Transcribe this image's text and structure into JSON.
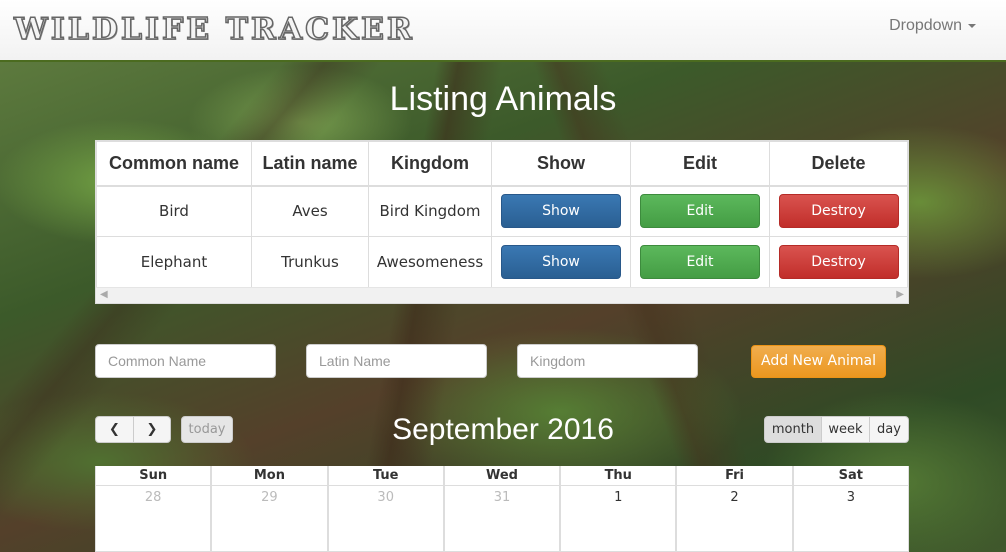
{
  "navbar": {
    "brand": "WILDLIFE TRACKER",
    "dropdown_label": "Dropdown"
  },
  "page_title": "Listing Animals",
  "table": {
    "headers": [
      "Common name",
      "Latin name",
      "Kingdom",
      "Show",
      "Edit",
      "Delete"
    ],
    "rows": [
      {
        "common": "Bird",
        "latin": "Aves",
        "kingdom": "Bird Kingdom",
        "show": "Show",
        "edit": "Edit",
        "destroy": "Destroy"
      },
      {
        "common": "Elephant",
        "latin": "Trunkus",
        "kingdom": "Awesomeness",
        "show": "Show",
        "edit": "Edit",
        "destroy": "Destroy"
      }
    ]
  },
  "form": {
    "common_placeholder": "Common Name",
    "latin_placeholder": "Latin Name",
    "kingdom_placeholder": "Kingdom",
    "add_label": "Add New Animal"
  },
  "calendar": {
    "title": "September 2016",
    "today_label": "today",
    "prev_icon": "chevron-left-icon",
    "next_icon": "chevron-right-icon",
    "views": [
      "month",
      "week",
      "day"
    ],
    "active_view": "month",
    "weekdays": [
      "Sun",
      "Mon",
      "Tue",
      "Wed",
      "Thu",
      "Fri",
      "Sat"
    ],
    "first_row": [
      "28",
      "29",
      "30",
      "31",
      "1",
      "2",
      "3"
    ]
  },
  "colors": {
    "show": "#2a5f92",
    "edit": "#449d44",
    "destroy": "#c12e2a",
    "add": "#ec971f"
  }
}
